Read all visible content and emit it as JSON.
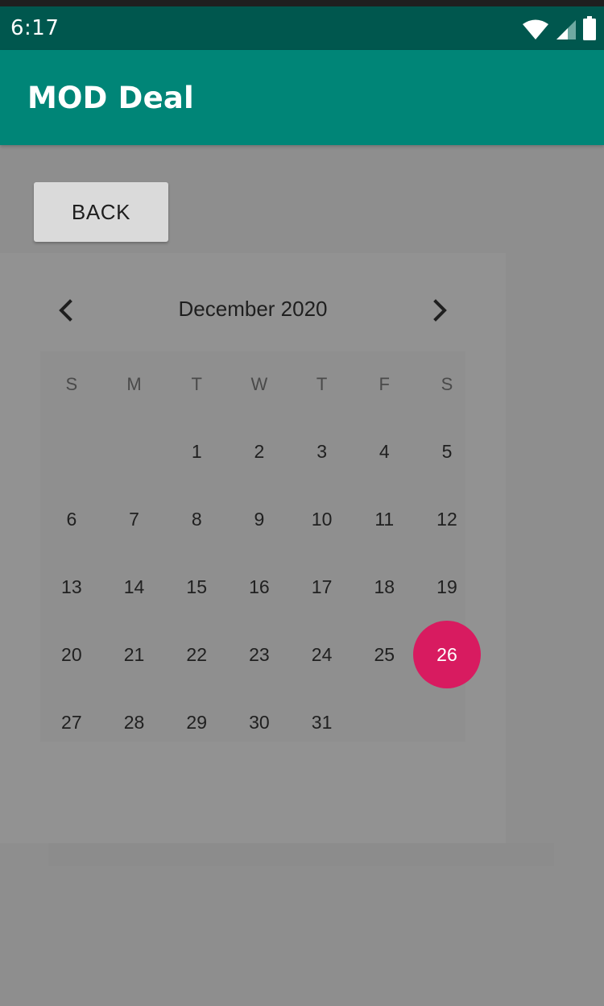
{
  "status_bar": {
    "time": "6:17",
    "icons": [
      "wifi-icon",
      "signal-icon",
      "battery-icon"
    ]
  },
  "app_bar": {
    "title": "MOD Deal",
    "color": "#008577"
  },
  "back_button": {
    "label": "BACK"
  },
  "calendar": {
    "month_label": "December 2020",
    "prev_icon": "chevron-left-icon",
    "next_icon": "chevron-right-icon",
    "weekdays": [
      "S",
      "M",
      "T",
      "W",
      "T",
      "F",
      "S"
    ],
    "weeks": [
      [
        "",
        "",
        "1",
        "2",
        "3",
        "4",
        "5"
      ],
      [
        "6",
        "7",
        "8",
        "9",
        "10",
        "11",
        "12"
      ],
      [
        "13",
        "14",
        "15",
        "16",
        "17",
        "18",
        "19"
      ],
      [
        "20",
        "21",
        "22",
        "23",
        "24",
        "25",
        "26"
      ],
      [
        "27",
        "28",
        "29",
        "30",
        "31",
        "",
        ""
      ]
    ],
    "selected_day": "26",
    "accent_color": "#d81b60"
  }
}
